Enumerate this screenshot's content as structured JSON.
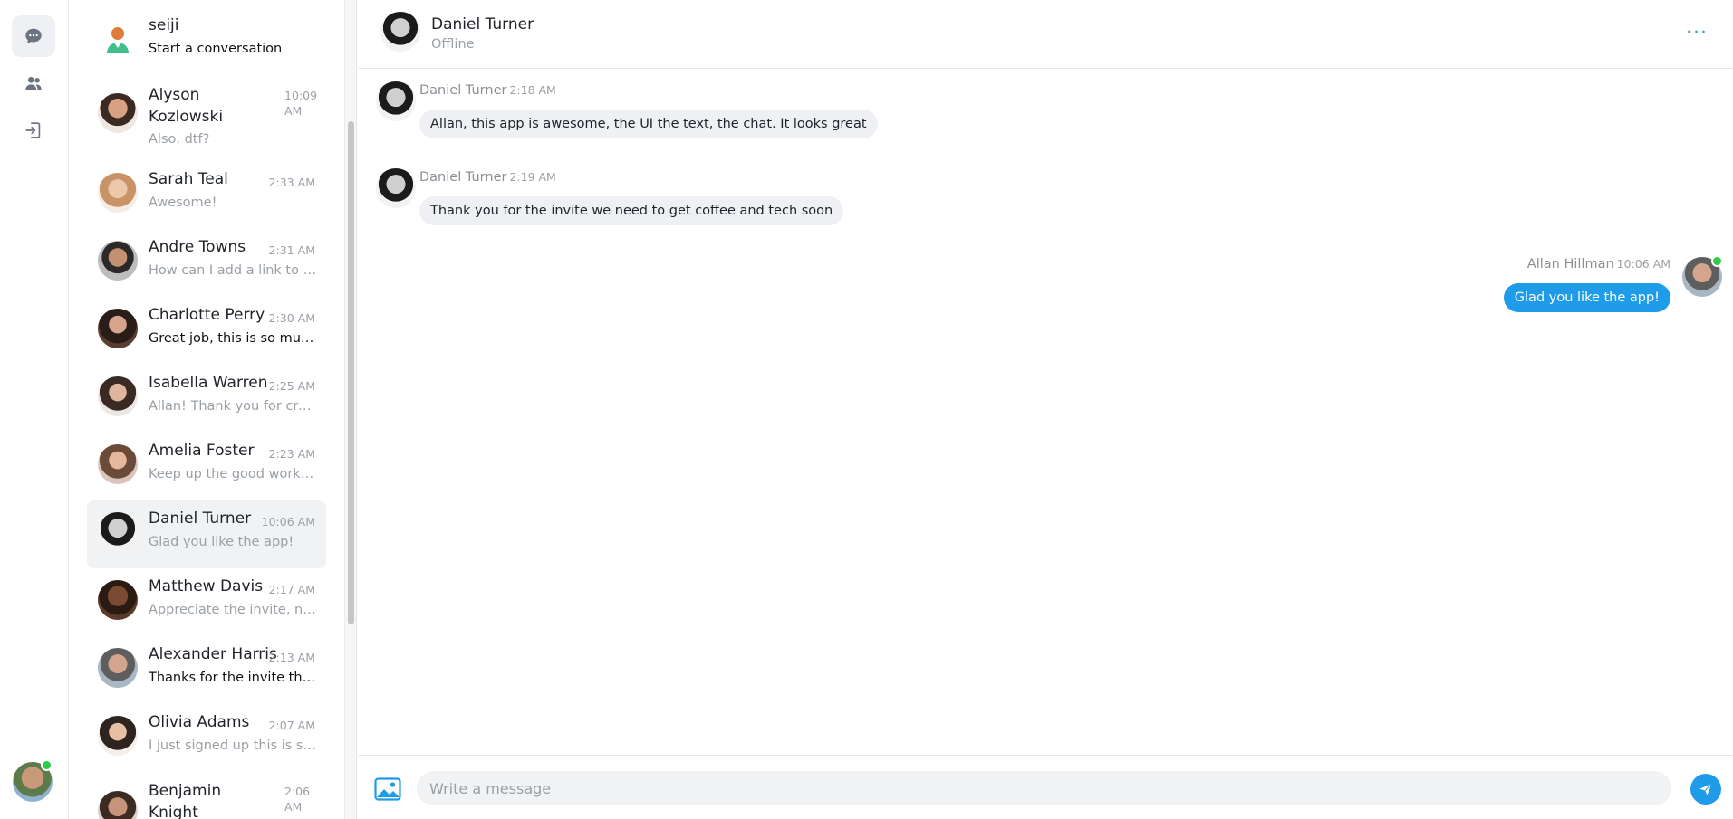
{
  "rail": {
    "items": [
      {
        "name": "chats",
        "icon": "chat-bubble-icon",
        "active": true
      },
      {
        "name": "contacts",
        "icon": "users-icon",
        "active": false
      },
      {
        "name": "logout",
        "icon": "logout-icon",
        "active": false
      }
    ],
    "current_user_status": "online"
  },
  "conversations": [
    {
      "name": "seiji",
      "time": "",
      "preview": "Start a conversation",
      "unread": true
    },
    {
      "name": "Alyson Kozlowski",
      "time": "10:09 AM",
      "preview": "Also, dtf?",
      "unread": false
    },
    {
      "name": "Sarah Teal",
      "time": "2:33 AM",
      "preview": "Awesome!",
      "unread": false
    },
    {
      "name": "Andre Towns",
      "time": "2:31 AM",
      "preview": "How can I add a link to my projects?",
      "unread": false
    },
    {
      "name": "Charlotte Perry",
      "time": "2:30 AM",
      "preview": "Great job, this is so much fun!",
      "unread": true
    },
    {
      "name": "Isabella Warren",
      "time": "2:25 AM",
      "preview": "Allan! Thank you for creating this app",
      "unread": false
    },
    {
      "name": "Amelia Foster",
      "time": "2:23 AM",
      "preview": "Keep up the good work! :)",
      "unread": false
    },
    {
      "name": "Daniel Turner",
      "time": "10:06 AM",
      "preview": "Glad you like the app!",
      "unread": false,
      "active": true
    },
    {
      "name": "Matthew Davis",
      "time": "2:17 AM",
      "preview": "Appreciate the invite, nice work",
      "unread": false
    },
    {
      "name": "Alexander Harris",
      "time": "2:13 AM",
      "preview": "Thanks for the invite this is great",
      "unread": true
    },
    {
      "name": "Olivia Adams",
      "time": "2:07 AM",
      "preview": "I just signed up this is super cool",
      "unread": false
    },
    {
      "name": "Benjamin Knight",
      "time": "2:06 AM",
      "preview": "",
      "unread": false
    }
  ],
  "chat": {
    "header": {
      "name": "Daniel Turner",
      "status": "Offline",
      "more_label": "···"
    },
    "messages": [
      {
        "sender": "Daniel Turner",
        "time": "2:18 AM",
        "text": "Allan, this app is awesome, the UI the text, the chat. It looks great",
        "direction": "in"
      },
      {
        "sender": "Daniel Turner",
        "time": "2:19 AM",
        "text": "Thank you for the invite we need to get coffee and tech soon",
        "direction": "in"
      },
      {
        "sender": "Allan Hillman",
        "time": "10:06 AM",
        "text": "Glad you like the app!",
        "direction": "out"
      }
    ],
    "composer": {
      "placeholder": "Write a message",
      "value": ""
    }
  },
  "colors": {
    "accent": "#1e9be9",
    "online": "#2ecc48",
    "bubble_in": "#eef0f3"
  }
}
